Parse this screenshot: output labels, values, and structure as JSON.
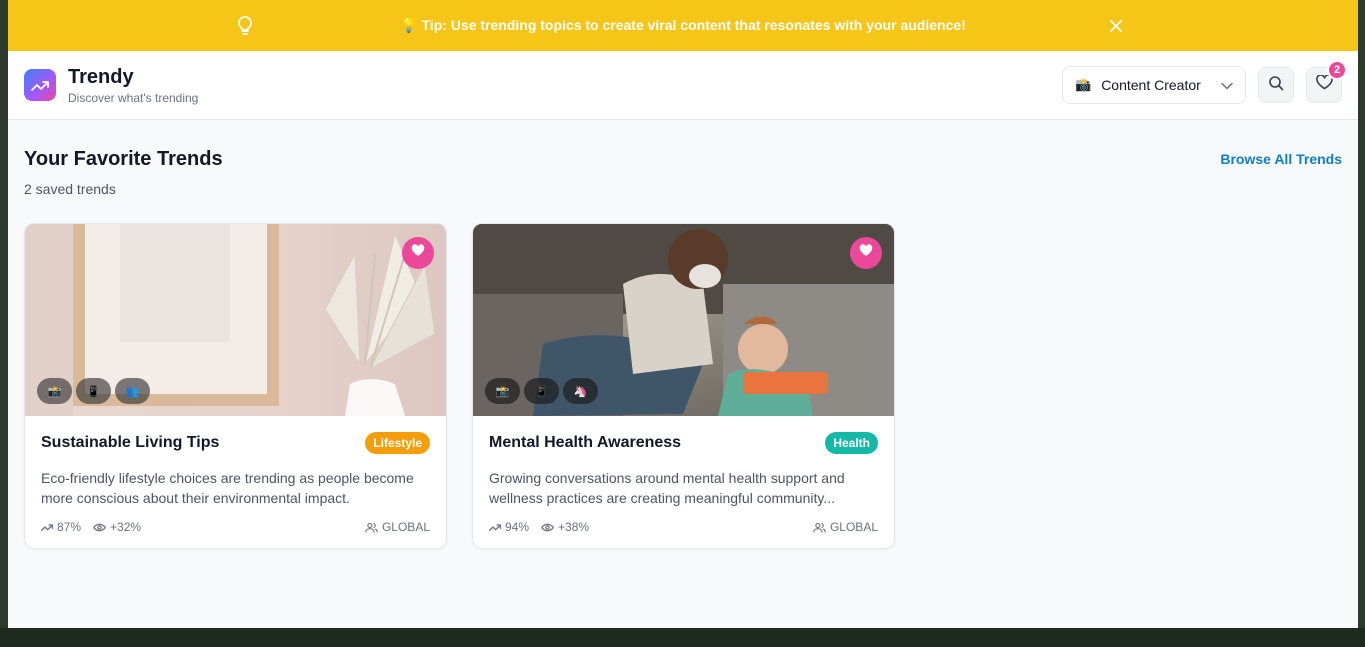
{
  "tip": {
    "text": "💡 Tip: Use trending topics to create viral content that resonates with your audience!"
  },
  "header": {
    "app_name": "Trendy",
    "tagline": "Discover what's trending",
    "role_select": {
      "emoji": "📸",
      "value": "Content Creator"
    },
    "favorites_count": "2"
  },
  "favorites": {
    "title": "Your Favorite Trends",
    "count_text": "2 saved trends",
    "browse_link": "Browse All Trends"
  },
  "cards": [
    {
      "title": "Sustainable Living Tips",
      "category": "Lifestyle",
      "category_color": "#f59e0b",
      "description": "Eco-friendly lifestyle choices are trending as people become more conscious about their environmental impact.",
      "growth": "87%",
      "views": "+32%",
      "region": "GLOBAL",
      "platforms": [
        "📸",
        "📱",
        "👥"
      ]
    },
    {
      "title": "Mental Health Awareness",
      "category": "Health",
      "category_color": "#14b8a6",
      "description": "Growing conversations around mental health support and wellness practices are creating meaningful community...",
      "growth": "94%",
      "views": "+38%",
      "region": "GLOBAL",
      "platforms": [
        "📸",
        "📱",
        "🦄"
      ]
    }
  ],
  "colors": {
    "tip_bar": "#f5c518",
    "accent_pink": "#ec4899",
    "link_blue": "#0e7fc0"
  }
}
